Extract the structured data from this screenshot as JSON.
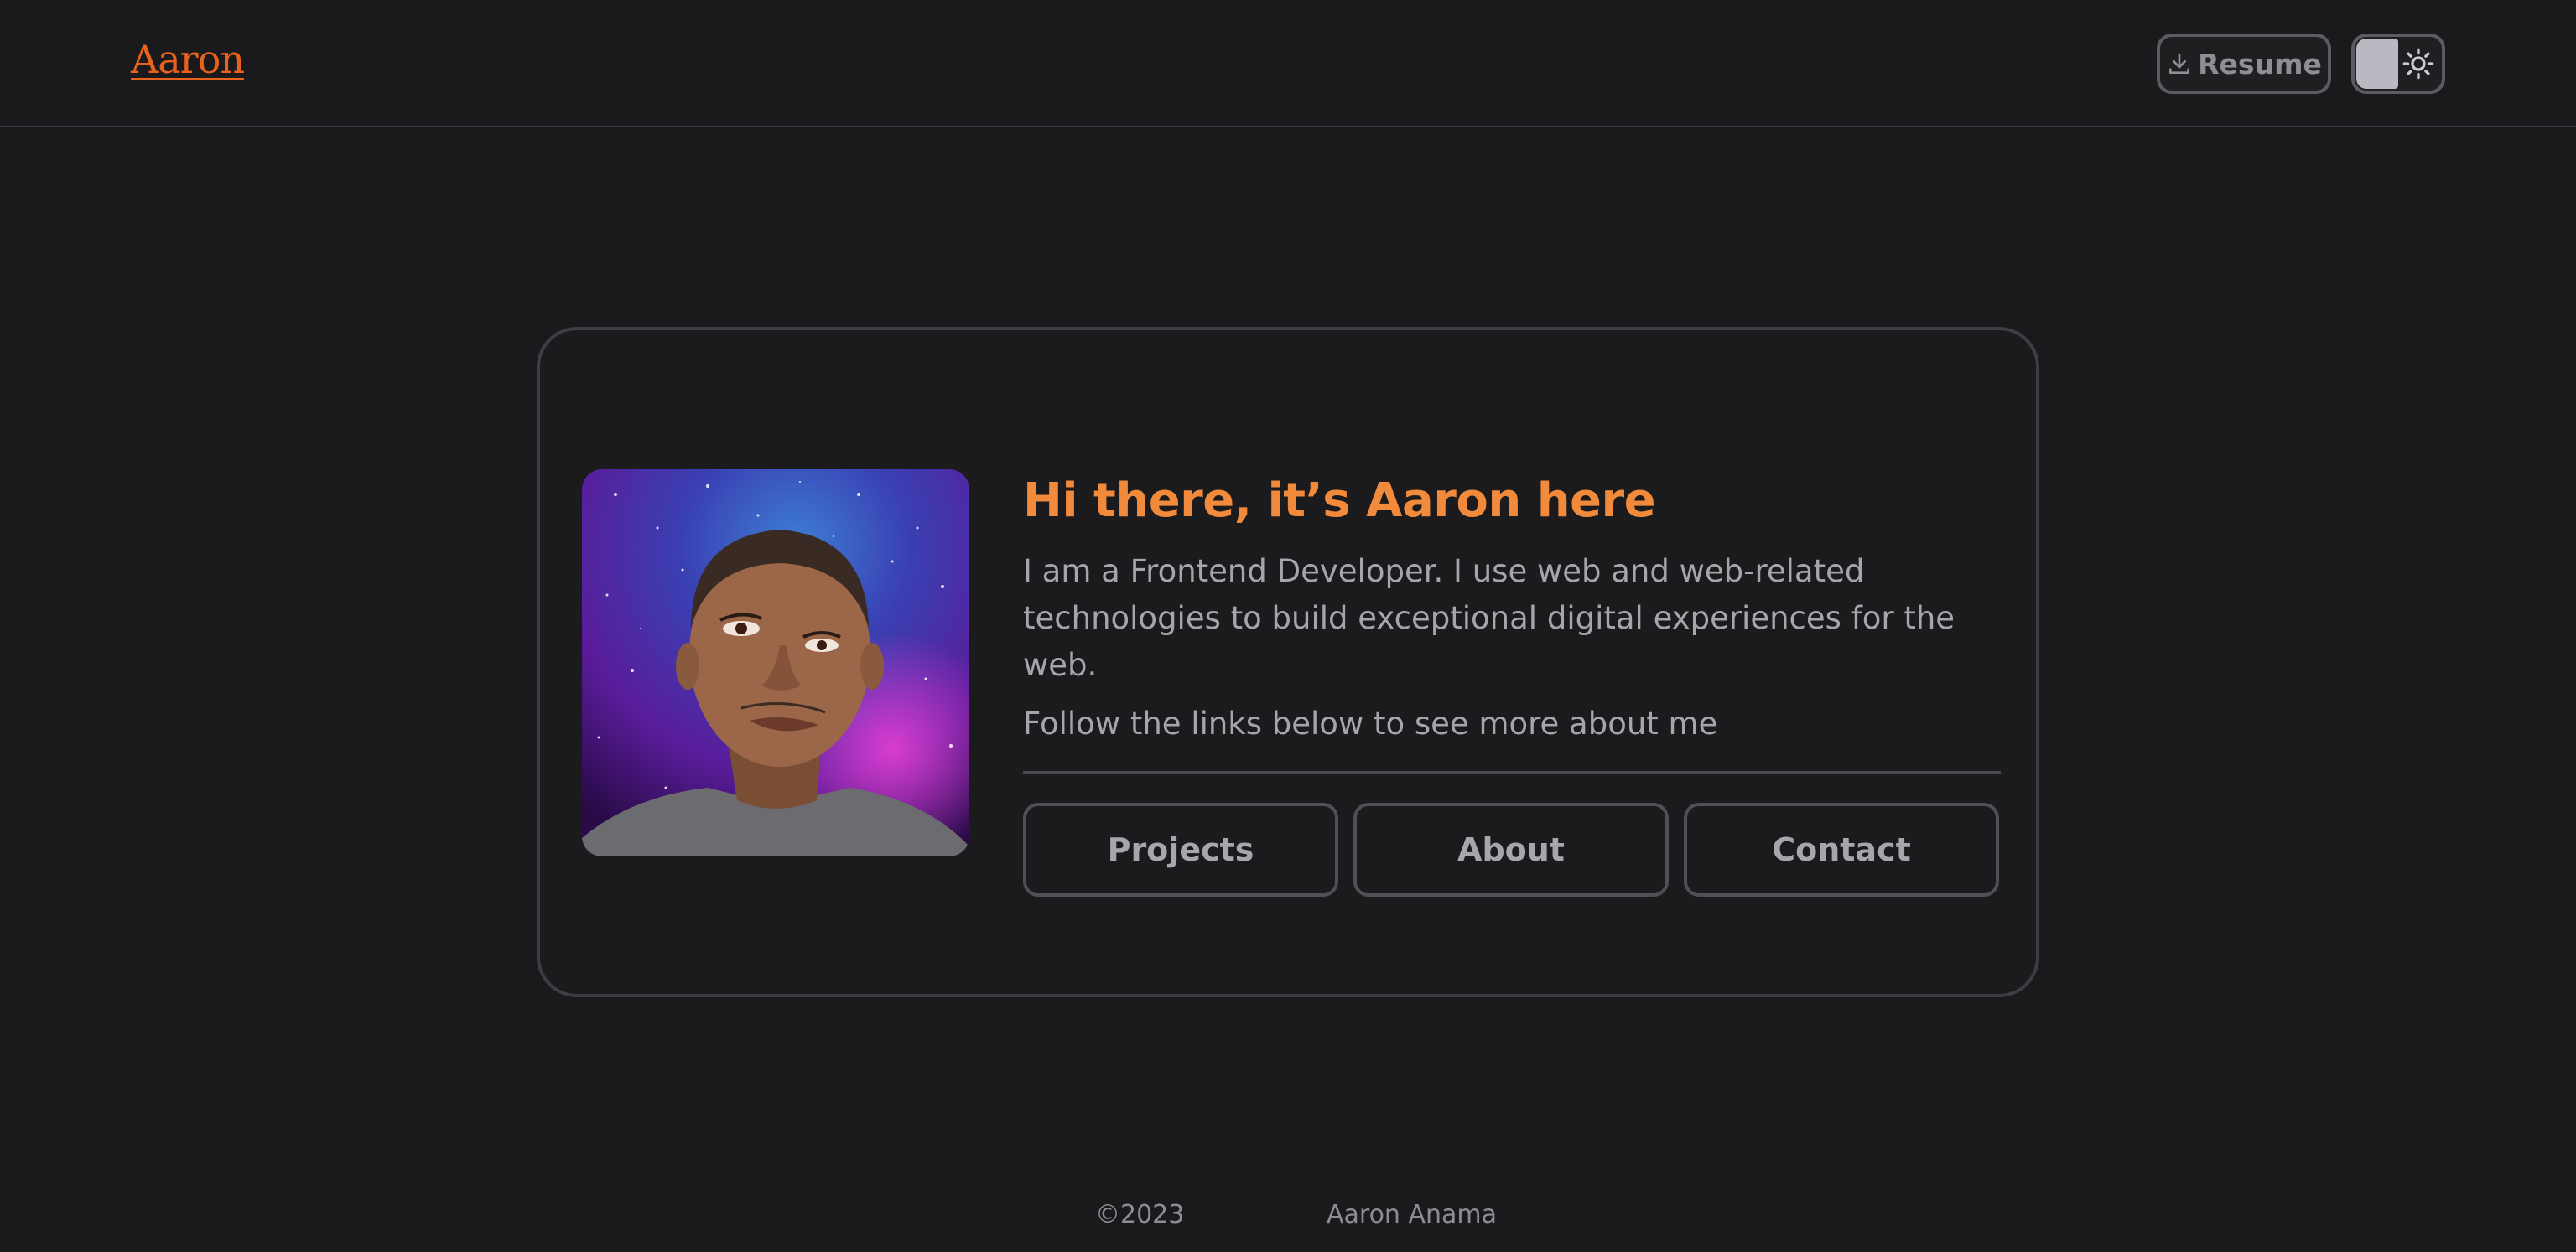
{
  "header": {
    "logo_text": "Aaron",
    "resume_label": "Resume",
    "theme_toggle": {
      "mode": "dark",
      "icon": "sun-icon"
    }
  },
  "hero": {
    "avatar_alt": "Aaron avatar",
    "greeting": "Hi there, it’s Aaron here",
    "intro": "I am a Frontend Developer. I use web and web-related technologies to build exceptional digital experiences for the web.",
    "follow": "Follow the links below to see more about me",
    "links": [
      {
        "label": "Projects"
      },
      {
        "label": "About"
      },
      {
        "label": "Contact"
      }
    ]
  },
  "footer": {
    "copyright": "©2023",
    "name": "Aaron Anama"
  },
  "colors": {
    "background": "#1a1a1c",
    "accent": "#f28a3c",
    "logo": "#e8621c",
    "border": "#4f4f54",
    "text": "#a5a5aa"
  }
}
